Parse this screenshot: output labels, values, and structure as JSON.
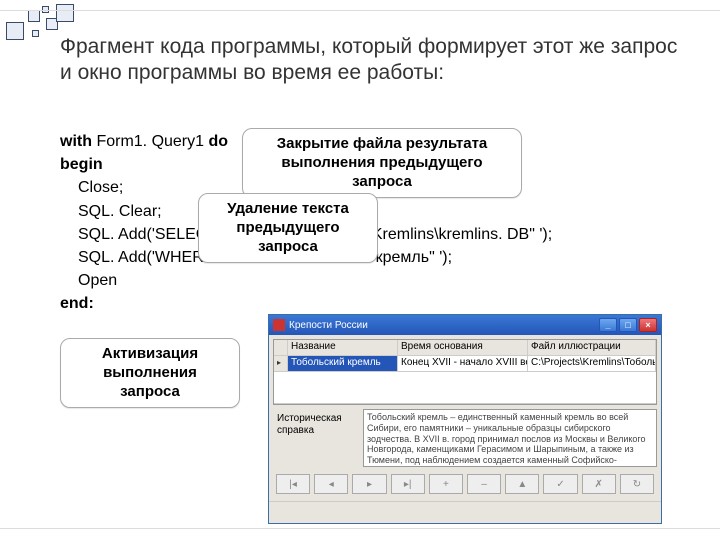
{
  "title": "Фрагмент кода программы, который формирует этот же запрос и окно программы во время ее работы:",
  "code": {
    "l1a": "with",
    "l1b": " Form1. Query1 ",
    "l1c": "do",
    "l2": "begin",
    "l3": "Close;",
    "l4": "SQL. Clear;",
    "l5": "SQL. Add('SELECT * FROM \"C:\\Projects\\Kremlins\\kremlins. DB\" ');",
    "l6": "SQL. Add('WHERE Name = \"Тобольский кремль\" ');",
    "l7": "Open",
    "l8": "end:"
  },
  "callouts": {
    "c1a": "Закрытие файла результата",
    "c1b": "выполнения предыдущего запроса",
    "c2a": "Удаление текста",
    "c2b": "предыдущего запроса",
    "c3a": "Активизация",
    "c3b": "выполнения запроса"
  },
  "win": {
    "title": "Крепости России",
    "min": "_",
    "max": "□",
    "close": "×",
    "headers": {
      "h1": "Название",
      "h2": "Время основания",
      "h3": "Файл иллюстрации"
    },
    "row": {
      "name": "Тобольский кремль",
      "time": "Конец XVII - начало XVIII века.",
      "file": "C:\\Projects\\Kremlins\\Тобольск\\Тобол"
    },
    "label": "Историческая справка",
    "memo": "Тобольский кремль – единственный каменный кремль во всей Сибири, его памятники – уникальные образцы сибирского зодчества. В XVII в. город принимал послов из Москвы и Великого Новгорода, каменщиками Герасимом и Шарыпиным, а также из Тюмени, под наблюдением создается каменный Софийско-Успенский собор. К",
    "nav": [
      "|◂",
      "◂",
      "▸",
      "▸|",
      "+",
      "–",
      "▲",
      "✓",
      "✗",
      "↻"
    ]
  }
}
